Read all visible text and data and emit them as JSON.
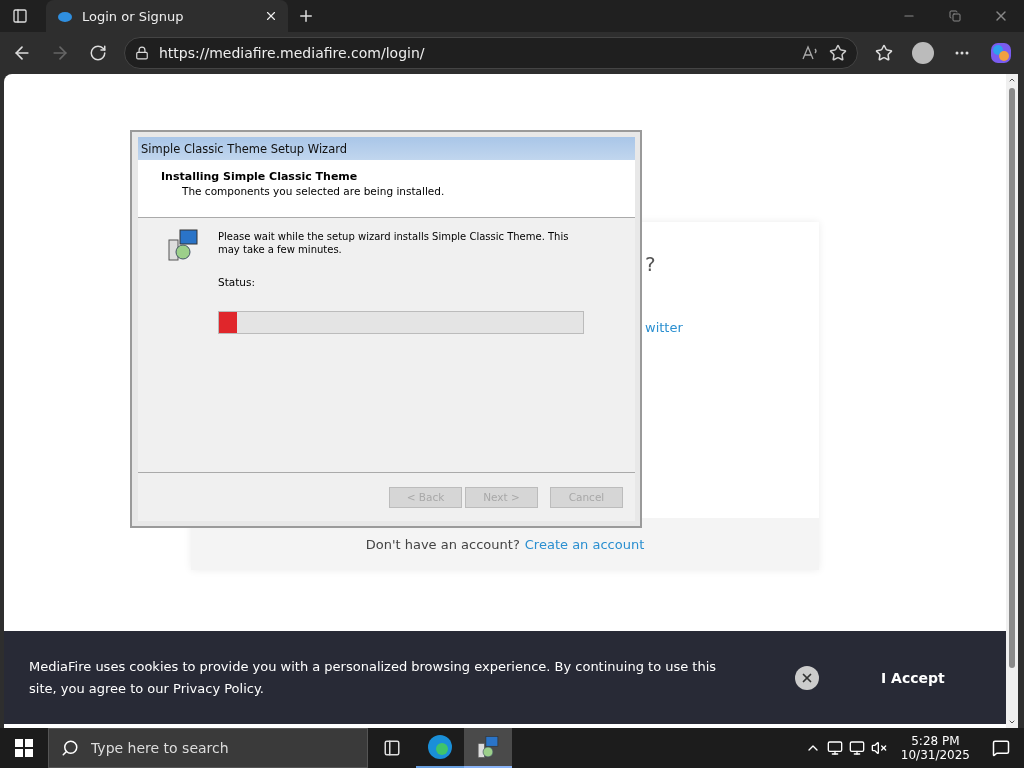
{
  "browser": {
    "tabs": [
      {
        "title": "Login or Signup",
        "selected": true
      }
    ],
    "nav": {
      "back_disabled": false,
      "forward_disabled": true
    },
    "address": "https://mediafire.mediafire.com/login/"
  },
  "page": {
    "card": {
      "fragments": [
        "?",
        "witter"
      ],
      "footer_text": "Don't have an account?",
      "footer_link": "Create an account"
    },
    "cookie_banner": {
      "text": "MediaFire uses cookies to provide you with a personalized browsing experience. By continuing to use this site, you agree to our Privacy Policy.",
      "accept": "I Accept"
    }
  },
  "wizard": {
    "title": "Simple Classic Theme Setup Wizard",
    "heading": "Installing Simple Classic Theme",
    "subheading": "The components you selected are being installed.",
    "message": "Please wait while the setup wizard installs Simple Classic Theme. This may take a few minutes.",
    "status_label": "Status:",
    "progress": {
      "level": 0.05
    },
    "buttons": [
      {
        "label": "< Back",
        "disabled": true
      },
      {
        "label": "Next >",
        "disabled": true
      },
      {
        "label": "Cancel",
        "disabled": true
      }
    ]
  },
  "taskbar": {
    "search_placeholder": "Type here to search",
    "apps": [
      {
        "kind": "edge",
        "selected": false
      },
      {
        "kind": "installer",
        "selected": true
      }
    ],
    "time": "5:28 PM",
    "date": "10/31/2025"
  }
}
